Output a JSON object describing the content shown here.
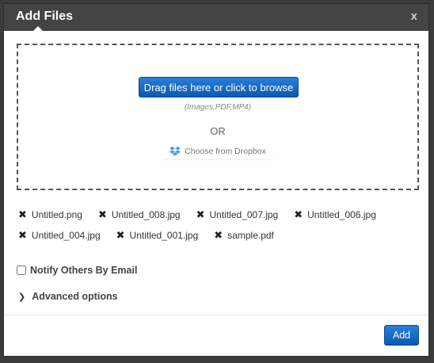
{
  "dialog": {
    "title": "Add Files",
    "close_label": "x"
  },
  "dropzone": {
    "browse_label": "Drag files here or click to browse",
    "hint": "(Images,PDF,MP4)",
    "or_label": "OR",
    "dropbox_label": "Choose from Dropbox",
    "dropbox_icon": "dropbox-icon"
  },
  "files": [
    {
      "name": "Untitled.png"
    },
    {
      "name": "Untitled_008.jpg"
    },
    {
      "name": "Untitled_007.jpg"
    },
    {
      "name": "Untitled_006.jpg"
    },
    {
      "name": "Untitled_004.jpg"
    },
    {
      "name": "Untitled_001.jpg"
    },
    {
      "name": "sample.pdf"
    }
  ],
  "remove_icon": "✖",
  "notify": {
    "label": "Notify Others By Email",
    "checked": false
  },
  "advanced": {
    "label": "Advanced options",
    "icon": "chevron-right-icon"
  },
  "footer": {
    "add_label": "Add"
  },
  "colors": {
    "header_bg": "#444444",
    "primary_button": "#0b58b3"
  }
}
